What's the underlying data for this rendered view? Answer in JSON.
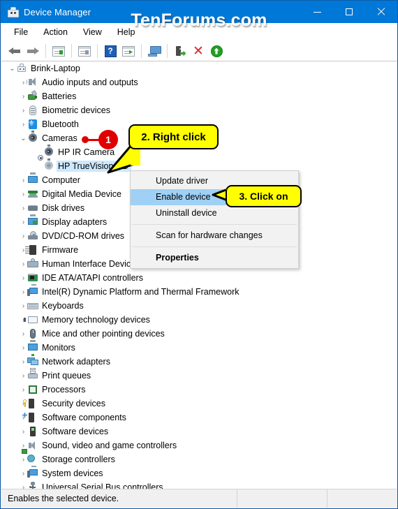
{
  "window": {
    "title": "Device Manager",
    "icon": "device-manager-icon",
    "watermark": "TenForums.com",
    "buttons": {
      "minimize": "minimize-button",
      "maximize": "maximize-button",
      "close": "close-button"
    },
    "accent_color": "#0078d7"
  },
  "menubar": {
    "items": [
      {
        "label": "File"
      },
      {
        "label": "Action"
      },
      {
        "label": "View"
      },
      {
        "label": "Help"
      }
    ]
  },
  "toolbar": {
    "items": [
      {
        "name": "back-arrow-icon"
      },
      {
        "name": "forward-arrow-icon"
      },
      {
        "name": "show-hide-console-tree-icon"
      },
      {
        "name": "properties-icon"
      },
      {
        "name": "help-icon"
      },
      {
        "name": "update-driver-icon"
      },
      {
        "name": "scan-for-hardware-changes-icon"
      },
      {
        "name": "enable-device-icon"
      },
      {
        "name": "uninstall-device-icon"
      },
      {
        "name": "update-device-icon"
      }
    ],
    "help_glyph": "?",
    "x_glyph": "✕"
  },
  "tree": {
    "root": {
      "label": "Brink-Laptop",
      "icon": "computer-icon",
      "expanded": true
    },
    "items": [
      {
        "label": "Audio inputs and outputs",
        "icon": "speaker-icon",
        "expanded": false,
        "level": 1
      },
      {
        "label": "Batteries",
        "icon": "battery-icon",
        "expanded": false,
        "level": 1
      },
      {
        "label": "Biometric devices",
        "icon": "fingerprint-icon",
        "expanded": false,
        "level": 1
      },
      {
        "label": "Bluetooth",
        "icon": "bluetooth-icon",
        "expanded": false,
        "level": 1
      },
      {
        "label": "Cameras",
        "icon": "camera-icon",
        "expanded": true,
        "level": 1
      },
      {
        "label": "HP IR Camera",
        "icon": "camera-icon",
        "level": 2
      },
      {
        "label": "HP TrueVision HD",
        "icon": "camera-disabled-icon",
        "level": 2,
        "selected": true
      },
      {
        "label": "Computer",
        "icon": "computer-monitor-icon",
        "expanded": false,
        "level": 1
      },
      {
        "label": "Digital Media Device",
        "icon": "media-device-icon",
        "expanded": false,
        "level": 1
      },
      {
        "label": "Disk drives",
        "icon": "disk-drive-icon",
        "expanded": false,
        "level": 1
      },
      {
        "label": "Display adapters",
        "icon": "display-adapter-icon",
        "expanded": false,
        "level": 1
      },
      {
        "label": "DVD/CD-ROM drives",
        "icon": "dvd-drive-icon",
        "expanded": false,
        "level": 1
      },
      {
        "label": "Firmware",
        "icon": "firmware-icon",
        "expanded": false,
        "level": 1
      },
      {
        "label": "Human Interface Devices",
        "icon": "hid-icon",
        "expanded": false,
        "level": 1
      },
      {
        "label": "IDE ATA/ATAPI controllers",
        "icon": "ide-controller-icon",
        "expanded": false,
        "level": 1
      },
      {
        "label": "Intel(R) Dynamic Platform and Thermal Framework",
        "icon": "system-device-icon",
        "expanded": false,
        "level": 1
      },
      {
        "label": "Keyboards",
        "icon": "keyboard-icon",
        "expanded": false,
        "level": 1
      },
      {
        "label": "Memory technology devices",
        "icon": "memory-icon",
        "expanded": false,
        "level": 1
      },
      {
        "label": "Mice and other pointing devices",
        "icon": "mouse-icon",
        "expanded": false,
        "level": 1
      },
      {
        "label": "Monitors",
        "icon": "monitor-icon",
        "expanded": false,
        "level": 1
      },
      {
        "label": "Network adapters",
        "icon": "network-adapter-icon",
        "expanded": false,
        "level": 1
      },
      {
        "label": "Print queues",
        "icon": "printer-icon",
        "expanded": false,
        "level": 1
      },
      {
        "label": "Processors",
        "icon": "processor-icon",
        "expanded": false,
        "level": 1
      },
      {
        "label": "Security devices",
        "icon": "security-device-icon",
        "expanded": false,
        "level": 1
      },
      {
        "label": "Software components",
        "icon": "software-component-icon",
        "expanded": false,
        "level": 1
      },
      {
        "label": "Software devices",
        "icon": "software-device-icon",
        "expanded": false,
        "level": 1
      },
      {
        "label": "Sound, video and game controllers",
        "icon": "sound-controller-icon",
        "expanded": false,
        "level": 1
      },
      {
        "label": "Storage controllers",
        "icon": "storage-controller-icon",
        "expanded": false,
        "level": 1
      },
      {
        "label": "System devices",
        "icon": "system-device-icon",
        "expanded": false,
        "level": 1
      },
      {
        "label": "Universal Serial Bus controllers",
        "icon": "usb-controller-icon",
        "expanded": false,
        "level": 1
      }
    ],
    "chevron_collapsed": "›",
    "chevron_expanded": "⌄"
  },
  "context_menu": {
    "items": [
      {
        "label": "Update driver",
        "highlight": false,
        "bold": false
      },
      {
        "label": "Enable device",
        "highlight": true,
        "bold": false
      },
      {
        "label": "Uninstall device",
        "highlight": false,
        "bold": false
      },
      {
        "separator": true
      },
      {
        "label": "Scan for hardware changes",
        "highlight": false,
        "bold": false
      },
      {
        "separator": true
      },
      {
        "label": "Properties",
        "highlight": false,
        "bold": true
      }
    ],
    "highlight_color": "#9fd0f5"
  },
  "annotations": {
    "step1_badge": "1",
    "step2_callout": "2. Right click",
    "step3_callout": "3. Click on",
    "badge_color": "#e00000",
    "callout_color": "#ffff00"
  },
  "statusbar": {
    "text": "Enables the selected device."
  }
}
